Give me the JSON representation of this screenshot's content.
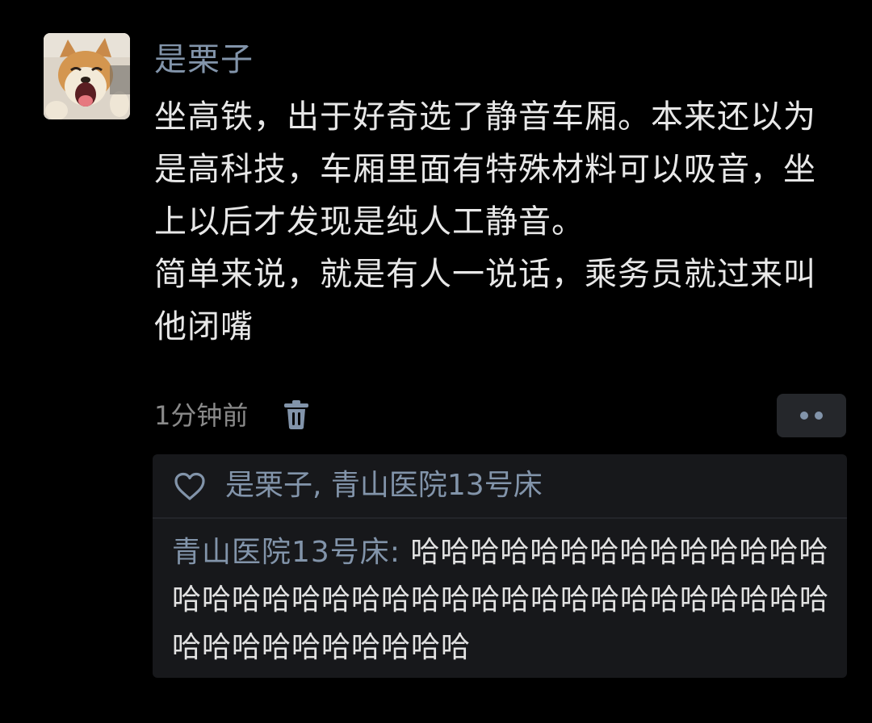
{
  "post": {
    "author": "是栗子",
    "lines": [
      "坐高铁，出于好奇选了静音车厢。本来还以为是高科技，车厢里面有特殊材料可以吸音，坐上以后才发现是纯人工静音。",
      "简单来说，就是有人一说话，乘务员就过来叫他闭嘴"
    ],
    "time": "1分钟前",
    "avatar_icon": "shiba-dog-avatar",
    "delete_icon": "trash-icon",
    "more_icon": "more-dots-icon"
  },
  "reactions": {
    "heart_icon": "heart-outline-icon",
    "likers": "是栗子, 青山医院13号床"
  },
  "comment": {
    "author": "青山医院13号床",
    "separator": ": ",
    "text": "哈哈哈哈哈哈哈哈哈哈哈哈哈哈哈哈哈哈哈哈哈哈哈哈哈哈哈哈哈哈哈哈哈哈哈哈哈哈哈哈哈哈哈哈哈哈"
  },
  "colors": {
    "background": "#000000",
    "name_blue": "#8294aa",
    "body_text": "#e8e8e8",
    "muted": "#8a8a8a",
    "panel": "#17181b"
  }
}
